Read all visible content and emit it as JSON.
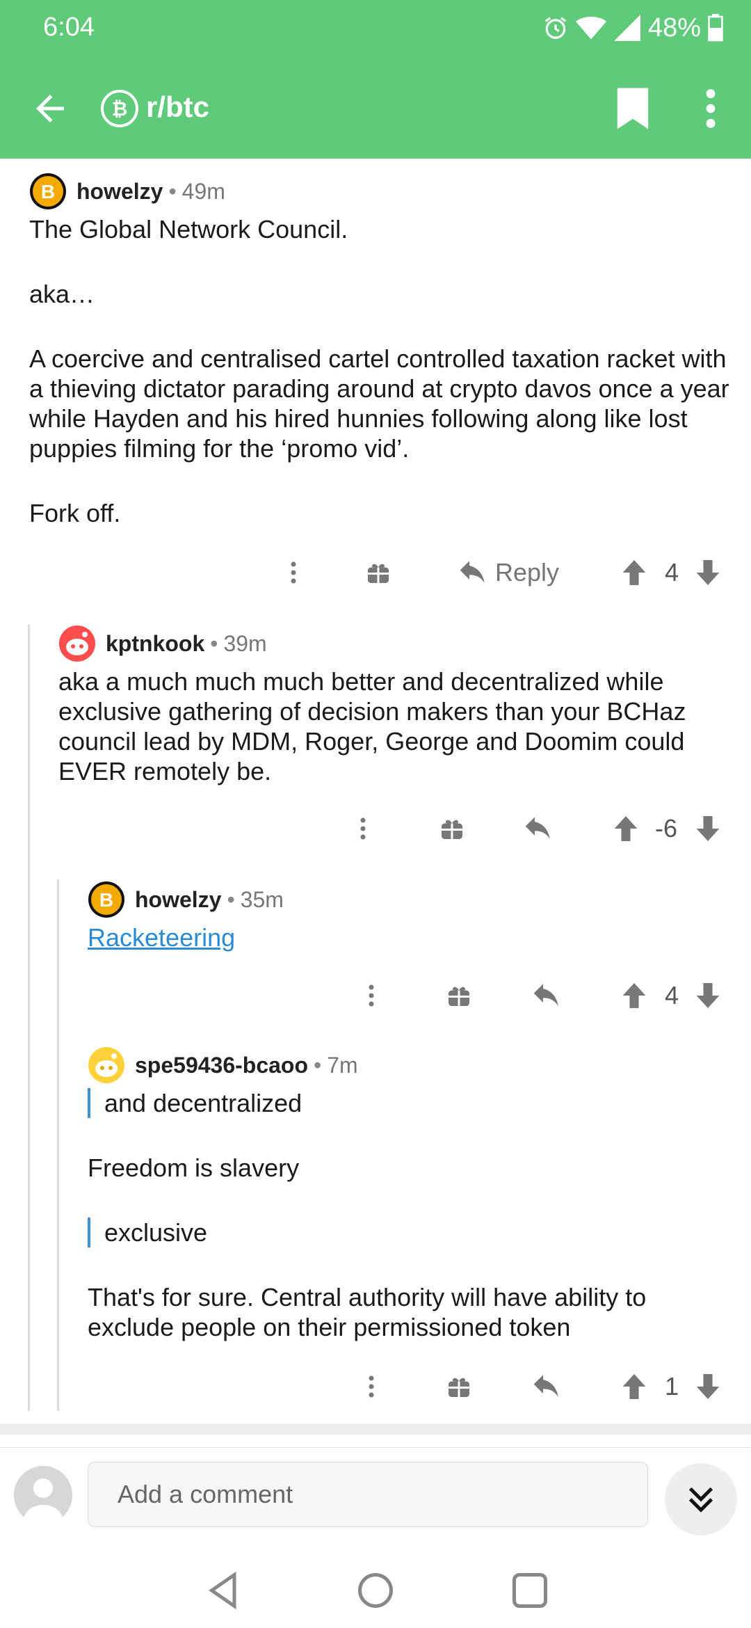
{
  "status_bar": {
    "time": "6:04",
    "battery": "48%"
  },
  "toolbar": {
    "subreddit": "r/btc"
  },
  "comments": [
    {
      "author": "howelzy",
      "age": "49m",
      "paragraphs": [
        "The Global Network Council.",
        "aka…",
        "A coercive and centralised cartel controlled taxation racket with a thieving dictator parading around at crypto davos once a year while Hayden and his hired hunnies following along like lost puppies filming for the ‘promo vid’.",
        "Fork off."
      ],
      "reply_label": "Reply",
      "score": "4"
    },
    {
      "author": "kptnkook",
      "age": "39m",
      "paragraphs": [
        "aka a much much much better and decentralized while exclusive gathering of decision makers than your BCHaz council lead by MDM, Roger, George and Doomim could EVER remotely be."
      ],
      "score": "-6"
    },
    {
      "author": "howelzy",
      "age": "35m",
      "link_text": "Racketeering",
      "score": "4"
    },
    {
      "author": "spe59436-bcaoo",
      "age": "7m",
      "paragraphs": [
        "and decentralized",
        "Freedom is slavery",
        "exclusive",
        "That's for sure. Central authority will have ability to exclude people on their permissioned token"
      ],
      "score": "1"
    }
  ],
  "composer": {
    "placeholder": "Add a comment"
  },
  "icons": {
    "back": "back-arrow-icon",
    "sub": "bitcoin-icon",
    "bookmark": "bookmark-icon",
    "more": "more-vert-icon",
    "award": "gift-icon",
    "reply": "reply-icon",
    "upvote": "upvote-arrow-icon",
    "downvote": "downvote-arrow-icon",
    "expand": "double-chevron-down-icon"
  },
  "colors": {
    "app_bar": "#5fcb7a",
    "link": "#2b8ad8",
    "quote_bar": "#3a8fd8"
  }
}
